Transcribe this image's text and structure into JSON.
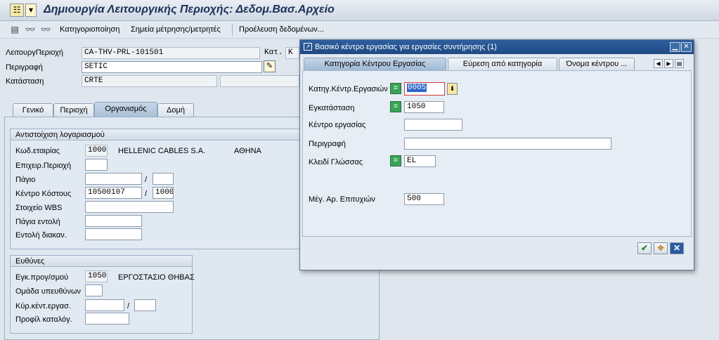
{
  "window": {
    "title": "Δημιουργία Λειτουργικής Περιοχής: Δεδομ.Βασ.Αρχείο"
  },
  "toolbar": {
    "icons": [
      "document-list-icon",
      "binoculars-icon",
      "binoculars-plus-icon"
    ],
    "items": [
      "Κατηγοριοποίηση",
      "Σημεία μέτρησης/μετρητές",
      "Προέλευση δεδομένων..."
    ]
  },
  "header": {
    "func_loc_label": "ΛειτουργΠεριοχή",
    "func_loc_value": "CA-THV-PRL-101501",
    "kat_label": "Κατ.",
    "kat_value": "K",
    "desc_label": "Περιγραφή",
    "desc_value": "SETIC",
    "status_label": "Κατάσταση",
    "status_value": "CRTE"
  },
  "tabs": [
    "Γενικό",
    "Περιοχή",
    "Οργανισμός",
    "Δομή"
  ],
  "active_tab": "Οργανισμός",
  "account_group": {
    "title": "Αντιστοίχιση λογαριασμού",
    "rows": [
      {
        "label": "Κωδ.εταιρίας",
        "value": "1000",
        "text1": "HELLENIC CABLES S.A.",
        "text2": "ΑΘΗΝΑ"
      },
      {
        "label": "Επιχειρ.Περιοχή",
        "value": ""
      },
      {
        "label": "Πάγιο",
        "value": "",
        "sep": "/",
        "value2": ""
      },
      {
        "label": "Κέντρο Κόστους",
        "value": "10500107",
        "sep": "/",
        "value2": "1000"
      },
      {
        "label": "Στοιχείο WBS",
        "value": ""
      },
      {
        "label": "Πάγια εντολή",
        "value": ""
      },
      {
        "label": "Εντολή διακαν.",
        "value": ""
      }
    ]
  },
  "resp_group": {
    "title": "Ευθύνες",
    "rows": [
      {
        "label": "Εγκ.προγ/σμού",
        "value": "1050",
        "text1": "ΕΡΓΟΣΤΑΣΙΟ ΘΗΒΑΣ"
      },
      {
        "label": "Ομάδα υπευθύνων",
        "value": ""
      },
      {
        "label": "Κύρ.κέντ.εργασ.",
        "value": "",
        "sep": "/",
        "value2": ""
      },
      {
        "label": "Προφίλ καταλόγ.",
        "value": ""
      }
    ]
  },
  "dialog": {
    "title": "Βασικό κέντρο εργασίας για εργασίες συντήρησης (1)",
    "tabs": [
      "Κατηγορία Κέντρου Εργασίας",
      "Εύρεση από κατηγορία",
      "Όνομα κέντρου ..."
    ],
    "fields": [
      {
        "label": "Κατηγ.Κέντρ.Εργασιών",
        "value": "0005",
        "has_select": true
      },
      {
        "label": "Εγκατάσταση",
        "value": "1050",
        "has_select": true
      },
      {
        "label": "Κέντρο εργασίας",
        "value": ""
      },
      {
        "label": "Περιγραφή",
        "value": ""
      },
      {
        "label": "Κλειδί Γλώσσας",
        "value": "EL",
        "has_select": true
      },
      {
        "label": "Μέγ. Αρ. Επιτυχιών",
        "value": "500"
      }
    ],
    "buttons": [
      "check-icon",
      "multi-select-icon",
      "cancel-icon"
    ]
  },
  "colors": {
    "title_text": "#1b2f57",
    "dialog_title_bg": "#2e5f9e",
    "green_select": "#3aa35a",
    "background": "#dfe6ee"
  }
}
